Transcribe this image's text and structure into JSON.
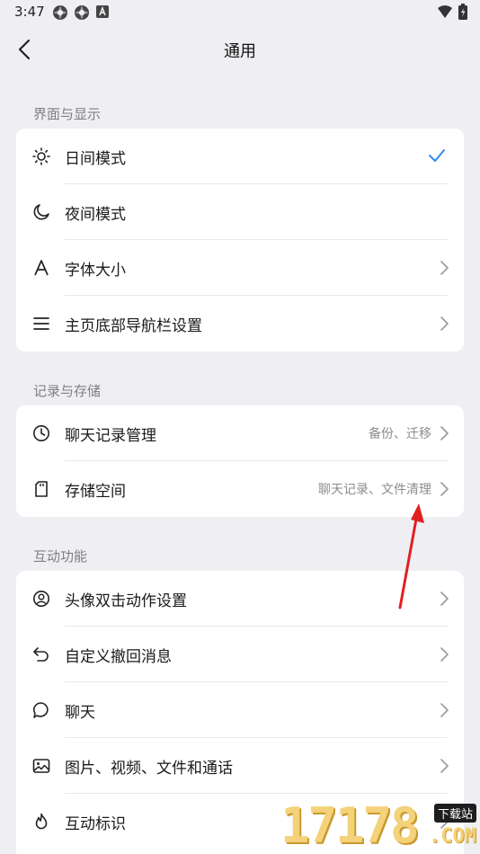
{
  "status_bar": {
    "time": "3:47",
    "left_icons": [
      "app-icon-1",
      "app-icon-2",
      "a-badge-icon"
    ],
    "right_icons": [
      "wifi-icon",
      "battery-icon"
    ]
  },
  "header": {
    "title": "通用",
    "back_icon": "chevron-left-icon"
  },
  "sections": [
    {
      "label": "界面与显示",
      "items": [
        {
          "label": "日间模式",
          "icon": "sun-icon",
          "selected": true
        },
        {
          "label": "夜间模式",
          "icon": "moon-icon"
        },
        {
          "label": "字体大小",
          "icon": "font-a-icon"
        },
        {
          "label": "主页底部导航栏设置",
          "icon": "menu-lines-icon"
        }
      ]
    },
    {
      "label": "记录与存储",
      "items": [
        {
          "label": "聊天记录管理",
          "icon": "clock-icon",
          "value": "备份、迁移"
        },
        {
          "label": "存储空间",
          "icon": "sd-card-icon",
          "value": "聊天记录、文件清理"
        }
      ]
    },
    {
      "label": "互动功能",
      "items": [
        {
          "label": "头像双击动作设置",
          "icon": "avatar-circle-icon"
        },
        {
          "label": "自定义撤回消息",
          "icon": "undo-icon"
        },
        {
          "label": "聊天",
          "icon": "chat-bubble-icon"
        },
        {
          "label": "图片、视频、文件和通话",
          "icon": "image-icon"
        },
        {
          "label": "互动标识",
          "icon": "flame-icon"
        }
      ]
    }
  ],
  "colors": {
    "background": "#efeff3",
    "card": "#ffffff",
    "accent_check": "#2d8cf0",
    "annotation_arrow": "#e02020"
  },
  "watermark": {
    "digits": "17178",
    "badge": "下载站",
    "domain": ".COM"
  }
}
